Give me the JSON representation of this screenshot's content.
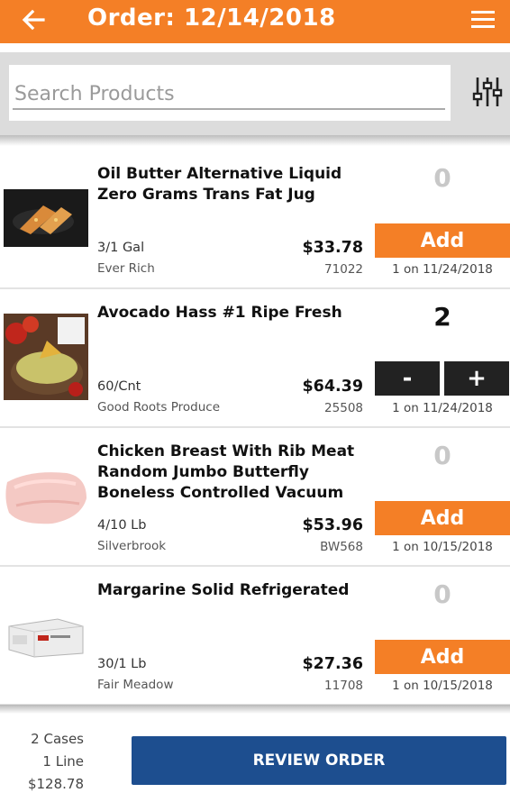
{
  "header": {
    "title": "Order: 12/14/2018",
    "bg_color": "#f47f26",
    "back_icon": "arrow-left-icon",
    "menu_icon": "hamburger-menu-icon"
  },
  "search": {
    "placeholder": "Search Products",
    "value": "",
    "filter_icon": "sliders-icon"
  },
  "products": [
    {
      "name": "Oil Butter Alternative Liquid Zero Grams Trans Fat Jug",
      "pack": "3/1 Gal",
      "brand": "Ever Rich",
      "price": "$33.78",
      "code": "71022",
      "qty": "0",
      "add_label": "Add",
      "last_ordered": "1 on 11/24/2018"
    },
    {
      "name": "Avocado Hass #1 Ripe Fresh",
      "pack": "60/Cnt",
      "brand": "Good Roots Produce",
      "price": "$64.39",
      "code": "25508",
      "qty": "2",
      "minus_label": "-",
      "plus_label": "+",
      "last_ordered": "1 on 11/24/2018"
    },
    {
      "name": "Chicken Breast With Rib Meat Random Jumbo Butterfly Boneless Controlled Vacuum",
      "pack": "4/10 Lb",
      "brand": "Silverbrook",
      "price": "$53.96",
      "code": "BW568",
      "qty": "0",
      "add_label": "Add",
      "last_ordered": "1 on 10/15/2018"
    },
    {
      "name": "Margarine Solid Refrigerated",
      "pack": "30/1 Lb",
      "brand": "Fair Meadow",
      "price": "$27.36",
      "code": "11708",
      "qty": "0",
      "add_label": "Add",
      "last_ordered": "1 on 10/15/2018"
    }
  ],
  "footer": {
    "cases": "2 Cases",
    "lines": "1 Line",
    "total": "$128.78",
    "review_label": "REVIEW ORDER",
    "review_color": "#1d4e8f"
  }
}
